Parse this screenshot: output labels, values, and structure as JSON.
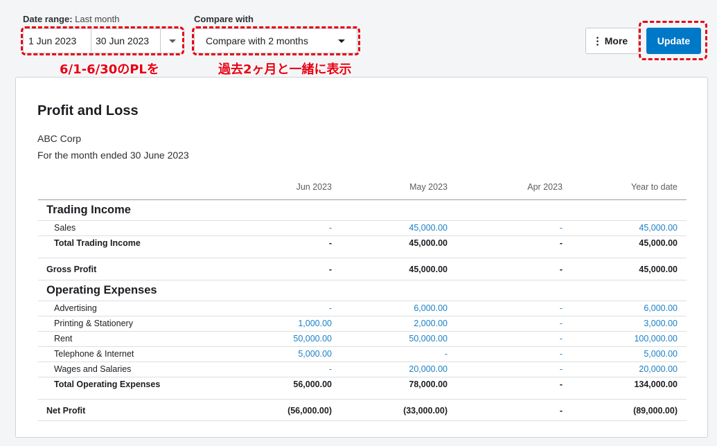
{
  "date_range": {
    "label": "Date range:",
    "preset": "Last month",
    "from": "1 Jun 2023",
    "to": "30 Jun 2023"
  },
  "compare": {
    "label": "Compare with",
    "value": "Compare with 2 months"
  },
  "toolbar": {
    "more_label": "More",
    "update_label": "Update"
  },
  "annotations": {
    "date_note": "6/1-6/30のPLを",
    "compare_note": "過去2ヶ月と一緒に表示"
  },
  "report": {
    "title": "Profit and Loss",
    "company": "ABC Corp",
    "period": "For the month ended 30 June 2023",
    "columns": [
      "Jun 2023",
      "May 2023",
      "Apr 2023",
      "Year to date"
    ],
    "trading_income": {
      "heading": "Trading Income",
      "rows": [
        {
          "name": "Sales",
          "values": [
            "-",
            "45,000.00",
            "-",
            "45,000.00"
          ]
        }
      ],
      "total": {
        "name": "Total Trading Income",
        "values": [
          "-",
          "45,000.00",
          "-",
          "45,000.00"
        ]
      }
    },
    "gross_profit": {
      "name": "Gross Profit",
      "values": [
        "-",
        "45,000.00",
        "-",
        "45,000.00"
      ]
    },
    "operating_expenses": {
      "heading": "Operating Expenses",
      "rows": [
        {
          "name": "Advertising",
          "values": [
            "-",
            "6,000.00",
            "-",
            "6,000.00"
          ]
        },
        {
          "name": "Printing & Stationery",
          "values": [
            "1,000.00",
            "2,000.00",
            "-",
            "3,000.00"
          ]
        },
        {
          "name": "Rent",
          "values": [
            "50,000.00",
            "50,000.00",
            "-",
            "100,000.00"
          ]
        },
        {
          "name": "Telephone & Internet",
          "values": [
            "5,000.00",
            "-",
            "-",
            "5,000.00"
          ]
        },
        {
          "name": "Wages and Salaries",
          "values": [
            "-",
            "20,000.00",
            "-",
            "20,000.00"
          ]
        }
      ],
      "total": {
        "name": "Total Operating Expenses",
        "values": [
          "56,000.00",
          "78,000.00",
          "-",
          "134,000.00"
        ]
      }
    },
    "net_profit": {
      "name": "Net Profit",
      "values": [
        "(56,000.00)",
        "(33,000.00)",
        "-",
        "(89,000.00)"
      ]
    }
  },
  "colors": {
    "accent": "#0078c8",
    "link": "#1a81c6",
    "annotation": "#e60012"
  }
}
